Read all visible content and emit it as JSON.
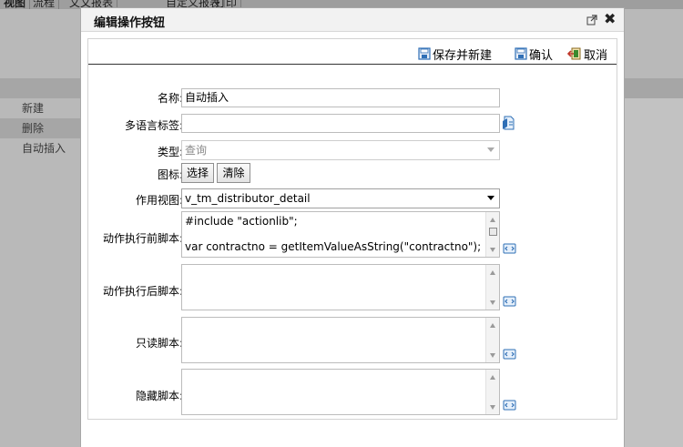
{
  "background": {
    "tabs": [
      "视图",
      "流程",
      "文文报表",
      "自定义报表",
      "打印"
    ],
    "list_items": [
      "新建",
      "删除",
      "自动插入"
    ]
  },
  "dialog": {
    "title": "编辑操作按钮",
    "toolbar": {
      "save_new": "保存并新建",
      "confirm": "确认",
      "cancel": "取消"
    },
    "fields": {
      "name_label": "名称:",
      "name_value": "自动插入",
      "i18n_label": "多语言标签:",
      "i18n_value": "",
      "type_label": "类型:",
      "type_value": "查询",
      "icon_label": "图标:",
      "icon_select_button": "选择",
      "icon_clear_button": "清除",
      "view_label": "作用视图:",
      "view_value": "v_tm_distributor_detail",
      "pre_script_label": "动作执行前脚本:",
      "pre_script_value": "#include \"actionlib\";\n\nvar contractno = getItemValueAsString(\"contractno\");",
      "post_script_label": "动作执行后脚本:",
      "post_script_value": "",
      "readonly_script_label": "只读脚本:",
      "readonly_script_value": "",
      "hidden_script_label": "隐藏脚本:",
      "hidden_script_value": ""
    }
  },
  "colors": {
    "overlay": "#b9b9b9",
    "dialog_bg": "#ffffff",
    "header_bg": "#f2f2f2",
    "icon_blue": "#2f6fb6",
    "icon_green": "#3a8a2e",
    "icon_red": "#c0392b"
  }
}
